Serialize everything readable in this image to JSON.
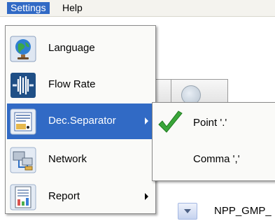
{
  "menubar": {
    "settings": "Settings",
    "help": "Help"
  },
  "menu": {
    "items": [
      {
        "label": "Language",
        "icon": "globe-icon",
        "submenu": false
      },
      {
        "label": "Flow Rate",
        "icon": "flow-rate-icon",
        "submenu": false
      },
      {
        "label": "Dec.Separator",
        "icon": "separator-icon",
        "submenu": true,
        "highlighted": true
      },
      {
        "label": "Network",
        "icon": "network-icon",
        "submenu": false
      },
      {
        "label": "Report",
        "icon": "report-icon",
        "submenu": true
      }
    ]
  },
  "submenu": {
    "items": [
      {
        "label": "Point '.'",
        "checked": true
      },
      {
        "label": "Comma ','",
        "checked": false
      }
    ]
  },
  "background": {
    "combo_text": "NPP_GMP_"
  },
  "colors": {
    "highlight": "#316ac5",
    "check": "#3aa63a"
  }
}
